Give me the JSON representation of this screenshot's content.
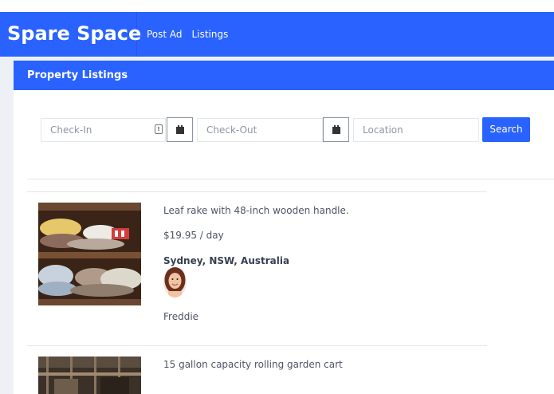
{
  "app": {
    "brand": "Spare Space"
  },
  "nav": {
    "items": [
      "Post Ad",
      "Listings"
    ]
  },
  "card": {
    "title": "Property Listings"
  },
  "search": {
    "checkin_placeholder": "Check-In",
    "checkout_placeholder": "Check-Out",
    "location_placeholder": "Location",
    "button_label": "Search"
  },
  "listings": [
    {
      "title": "Leaf rake with 48-inch wooden handle.",
      "price": "$19.95 / day",
      "location": "Sydney, NSW, Australia",
      "owner": "Freddie"
    },
    {
      "title": "15 gallon capacity rolling garden cart"
    }
  ],
  "colors": {
    "brand": "#2962ff",
    "page_bg": "#edf1f5"
  }
}
